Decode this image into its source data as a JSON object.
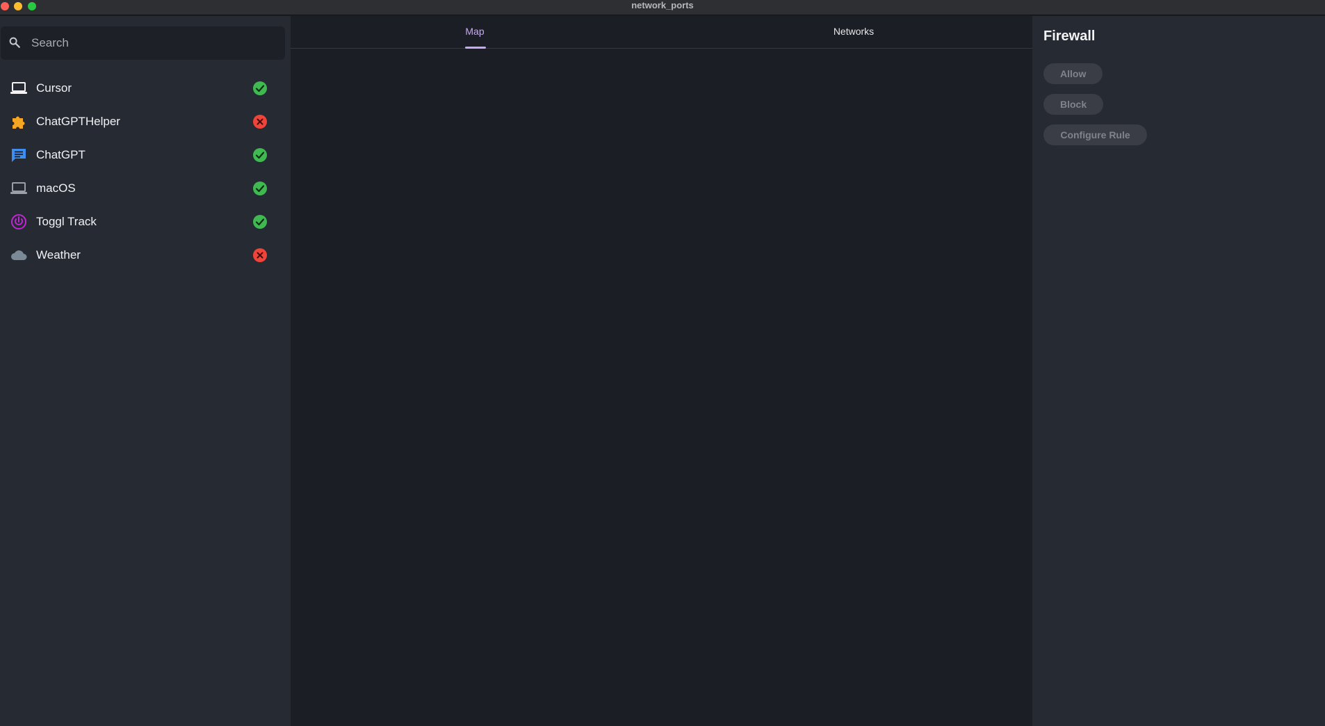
{
  "window": {
    "title": "network_ports"
  },
  "search": {
    "placeholder": "Search",
    "value": ""
  },
  "apps": [
    {
      "label": "Cursor",
      "icon": "laptop-icon",
      "status": "allowed"
    },
    {
      "label": "ChatGPTHelper",
      "icon": "puzzle-icon",
      "status": "blocked"
    },
    {
      "label": "ChatGPT",
      "icon": "chat-icon",
      "status": "allowed"
    },
    {
      "label": "macOS",
      "icon": "laptop-icon",
      "status": "allowed"
    },
    {
      "label": "Toggl Track",
      "icon": "toggl-icon",
      "status": "allowed"
    },
    {
      "label": "Weather",
      "icon": "cloud-icon",
      "status": "blocked"
    }
  ],
  "tabs": [
    {
      "label": "Map",
      "active": true
    },
    {
      "label": "Networks",
      "active": false
    }
  ],
  "panel": {
    "title": "Firewall",
    "buttons": {
      "allow": "Allow",
      "block": "Block",
      "configure": "Configure Rule"
    }
  },
  "colors": {
    "accent": "#c9a8f5",
    "allowed": "#3fb950",
    "blocked": "#f0443a",
    "puzzle": "#f5a623",
    "chat": "#3d8ef0",
    "toggl": "#c026d3",
    "cloud": "#7a8a96"
  }
}
